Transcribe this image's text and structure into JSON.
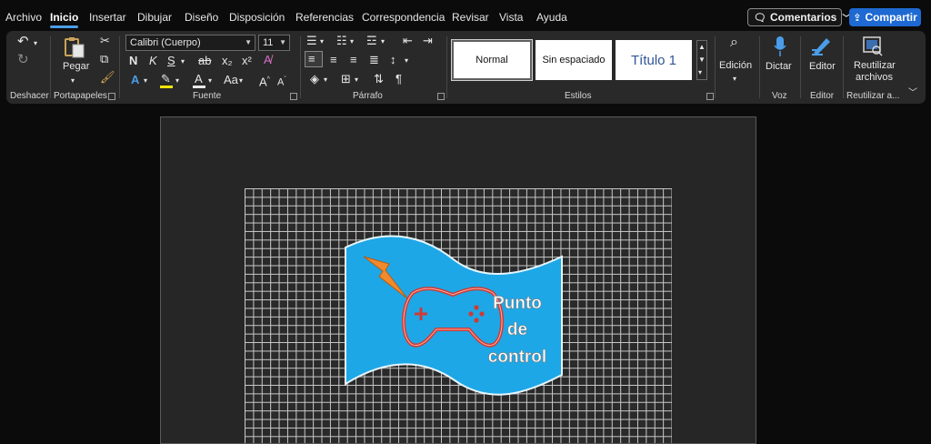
{
  "menu": {
    "tabs": [
      "Archivo",
      "Inicio",
      "Insertar",
      "Dibujar",
      "Diseño",
      "Disposición",
      "Referencias",
      "Correspondencia",
      "Revisar",
      "Vista",
      "Ayuda"
    ],
    "active": "Inicio",
    "comments_label": "Comentarios",
    "share_label": "Compartir"
  },
  "ribbon": {
    "groups": {
      "undo": "Deshacer",
      "clipboard": "Portapapeles",
      "font": "Fuente",
      "paragraph": "Párrafo",
      "styles": "Estilos",
      "voice": "Voz",
      "editor": "Editor",
      "reuse": "Reutilizar a..."
    },
    "paste_label": "Pegar",
    "font_name": "Calibri (Cuerpo)",
    "font_size": "11",
    "bold": "N",
    "italic": "K",
    "underline": "S",
    "strike": "ab",
    "subscript": "x₂",
    "superscript": "x²",
    "change_case": "Aa",
    "grow": "A",
    "shrink": "A",
    "styles": [
      "Normal",
      "Sin espaciado",
      "Título 1"
    ],
    "editing_label": "Edición",
    "dictate_label": "Dictar",
    "editor_label": "Editor",
    "reuse_label_1": "Reutilizar",
    "reuse_label_2": "archivos"
  },
  "document": {
    "logo_text_lines": [
      "Punto",
      "de",
      "control"
    ]
  },
  "colors": {
    "accent": "#1e69d2",
    "flag_fill": "#1ea7e6",
    "logo_red": "#d03a32",
    "bolt": "#f08a2c"
  }
}
